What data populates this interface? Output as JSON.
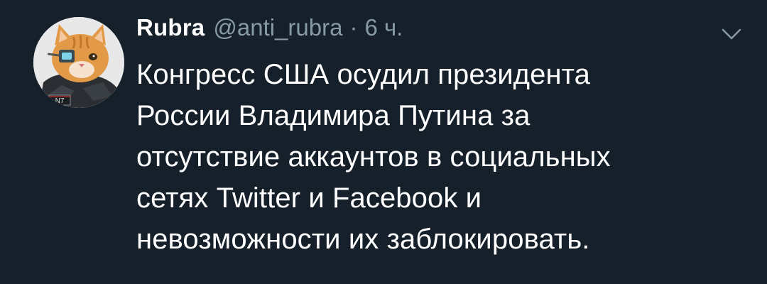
{
  "tweet": {
    "display_name": "Rubra",
    "handle": "@anti_rubra",
    "separator": "·",
    "time": "6 ч.",
    "avatar_badge": "N7",
    "lines": [
      "Конгресс США осудил президента",
      "России Владимира Путина за",
      "отсутствие аккаунтов в социальных",
      "сетях Twitter и Facebook и",
      "невозможности их заблокировать."
    ],
    "caret_icon": "chevron-down-icon"
  },
  "colors": {
    "background": "#15202b",
    "primary_text": "#ffffff",
    "secondary_text": "#8899a6"
  }
}
